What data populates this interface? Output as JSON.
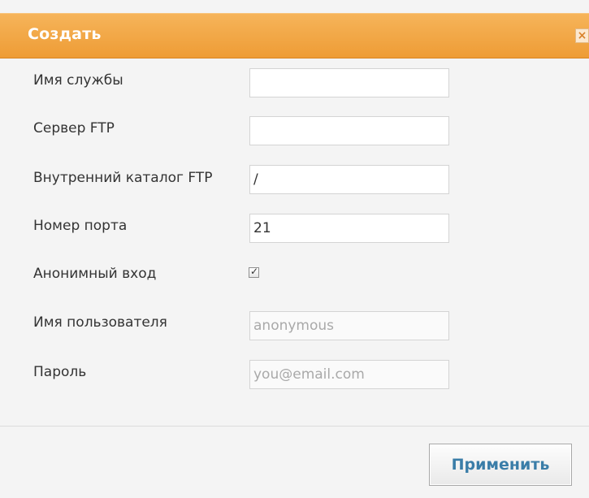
{
  "dialog": {
    "title": "Создать",
    "close_glyph": "×",
    "close_icon": "close-icon"
  },
  "form": {
    "service_name": {
      "label": "Имя службы",
      "value": "",
      "placeholder": ""
    },
    "ftp_server": {
      "label": "Сервер FTP",
      "value": "",
      "placeholder": ""
    },
    "ftp_dir": {
      "label": "Внутренний каталог FTP",
      "value": "/",
      "placeholder": ""
    },
    "port": {
      "label": "Номер порта",
      "value": "21",
      "placeholder": ""
    },
    "anonymous": {
      "label": "Анонимный вход",
      "checked": true,
      "check_glyph": "✓",
      "check_icon": "checkmark-icon"
    },
    "username": {
      "label": "Имя пользователя",
      "value": "",
      "placeholder": "anonymous"
    },
    "password": {
      "label": "Пароль",
      "value": "",
      "placeholder": "you@email.com"
    }
  },
  "footer": {
    "apply_label": "Применить"
  },
  "colors": {
    "title_bar": "#f0a040",
    "title_text": "#ffffff",
    "button_text": "#3a7da8",
    "background": "#f4f4f4"
  }
}
